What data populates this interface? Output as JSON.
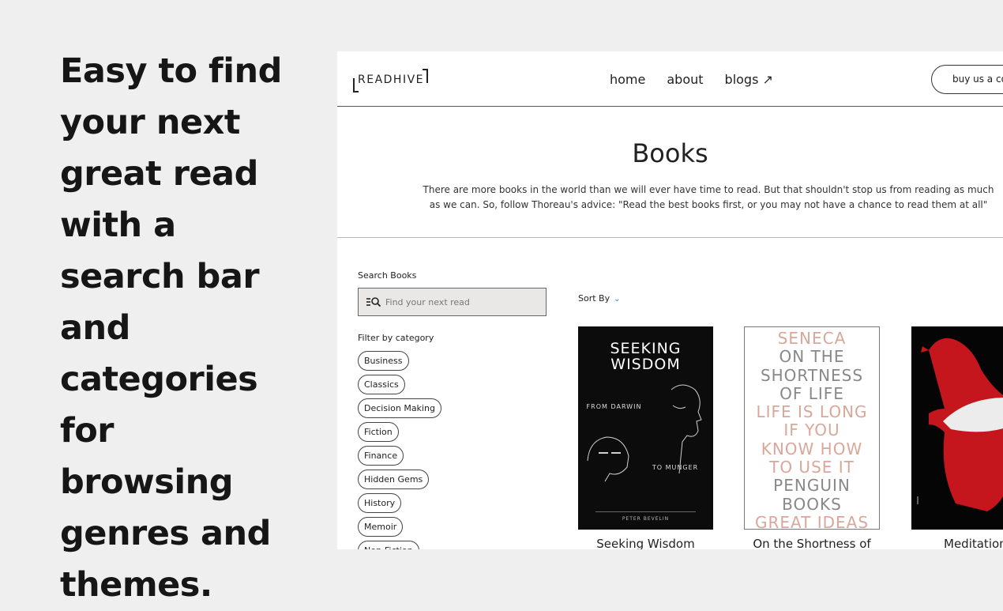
{
  "headline": "Easy to find your next great read with a search bar and categories for browsing genres and themes.",
  "nav": {
    "logo": "READHIVE",
    "links": [
      "home",
      "about",
      "blogs ↗"
    ],
    "cta": "buy us a co"
  },
  "hero": {
    "title": "Books",
    "quote": "There are more books in the world than we will ever have time to read. But that shouldn't stop us from reading as much as we can. So, follow Thoreau's advice: \"Read the best books first, or you may not have a chance to read them at all\""
  },
  "search": {
    "label": "Search Books",
    "placeholder": "Find your next read",
    "icon": "search-filter-icon"
  },
  "filter": {
    "label": "Filter by category",
    "categories": [
      "Business",
      "Classics",
      "Decision Making",
      "Fiction",
      "Finance",
      "Hidden Gems",
      "History",
      "Memoir",
      "Non-Fiction"
    ]
  },
  "sort": {
    "label": "Sort By",
    "icon": "chevron-down-icon"
  },
  "books": [
    {
      "caption": "Seeking Wisdom",
      "cover_title": "SEEKING WISDOM",
      "cover_from": "FROM DARWIN",
      "cover_to": "TO MUNGER",
      "cover_author": "PETER BEVELIN"
    },
    {
      "caption": "On the Shortness of",
      "cover_lines": [
        "SENECA",
        "ON THE",
        "SHORTNESS",
        "OF LIFE",
        "LIFE IS LONG",
        "IF YOU",
        "KNOW HOW",
        "TO USE IT",
        "PENGUIN",
        "BOOKS",
        "GREAT IDEAS"
      ],
      "cover_line_colors": [
        "#d9a79a",
        "#888888",
        "#888888",
        "#888888",
        "#d9a79a",
        "#d9a79a",
        "#d9a79a",
        "#d9a79a",
        "#888888",
        "#888888",
        "#d9a79a"
      ]
    },
    {
      "caption": "Meditation"
    }
  ],
  "colors": {
    "accent": "#3a6cd8",
    "page_bg": "#efefef",
    "cover_red": "#c4161c"
  }
}
